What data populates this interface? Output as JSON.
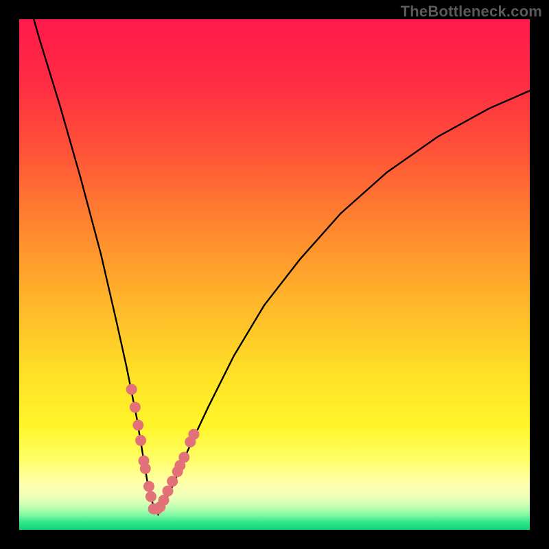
{
  "watermark": "TheBottleneck.com",
  "colors": {
    "frame": "#000000",
    "marker_fill": "#e37179",
    "curve_stroke": "#000000",
    "watermark_text": "#5a5a5a",
    "gradient_stops": [
      {
        "offset": 0.0,
        "color": "#ff1a4b"
      },
      {
        "offset": 0.12,
        "color": "#ff2b44"
      },
      {
        "offset": 0.25,
        "color": "#ff5038"
      },
      {
        "offset": 0.4,
        "color": "#ff842f"
      },
      {
        "offset": 0.55,
        "color": "#ffb52a"
      },
      {
        "offset": 0.7,
        "color": "#ffe226"
      },
      {
        "offset": 0.8,
        "color": "#fff62a"
      },
      {
        "offset": 0.865,
        "color": "#ffff6a"
      },
      {
        "offset": 0.912,
        "color": "#ffffb0"
      },
      {
        "offset": 0.94,
        "color": "#e8ffb9"
      },
      {
        "offset": 0.958,
        "color": "#b6ffb1"
      },
      {
        "offset": 0.972,
        "color": "#7cf8a0"
      },
      {
        "offset": 0.985,
        "color": "#2fe889"
      },
      {
        "offset": 1.0,
        "color": "#16d47a"
      }
    ]
  },
  "chart_data": {
    "type": "line",
    "title": "",
    "xlabel": "",
    "ylabel": "",
    "xlim": [
      0,
      100
    ],
    "ylim": [
      0,
      100
    ],
    "series": [
      {
        "name": "bottleneck-curve",
        "x": [
          0,
          4,
          8,
          12,
          16,
          19,
          21,
          23,
          24.5,
          25.5,
          26.5,
          27.2,
          28,
          30,
          33,
          37,
          42,
          48,
          55,
          63,
          72,
          82,
          92,
          100
        ],
        "y": [
          110,
          96,
          83,
          69,
          54,
          41,
          32,
          22,
          13,
          7,
          4.2,
          3,
          4.3,
          8.5,
          15.5,
          24,
          34,
          44,
          53,
          62,
          70,
          77,
          82.5,
          86
        ]
      }
    ],
    "markers": {
      "name": "highlight-points",
      "x": [
        22.0,
        22.7,
        23.3,
        23.8,
        24.4,
        24.7,
        25.4,
        25.8,
        26.3,
        26.5,
        27.1,
        27.6,
        28.3,
        29.1,
        30.0,
        31.0,
        31.5,
        32.3,
        33.5,
        34.2
      ],
      "y": [
        27.5,
        24.0,
        20.5,
        17.5,
        13.5,
        12.0,
        8.5,
        6.5,
        4.1,
        4.1,
        4.1,
        4.5,
        5.8,
        7.6,
        9.5,
        11.4,
        12.6,
        14.2,
        17.2,
        18.7
      ]
    }
  }
}
